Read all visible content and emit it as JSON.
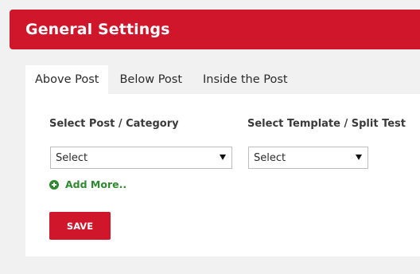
{
  "header": {
    "title": "General Settings"
  },
  "tabs": [
    {
      "label": "Above Post",
      "active": true
    },
    {
      "label": "Below Post",
      "active": false
    },
    {
      "label": "Inside the Post",
      "active": false
    }
  ],
  "form": {
    "post_category_label": "Select Post / Category",
    "template_label": "Select Template / Split Test",
    "post_category_select": {
      "value": "Select"
    },
    "template_select": {
      "value": "Select"
    },
    "add_more_label": "Add More..",
    "save_label": "SAVE"
  },
  "colors": {
    "brand": "#d0162a",
    "add_more": "#2e8a2e",
    "background": "#f1f1f1"
  },
  "icons": {
    "add_more": "plus-circle-icon",
    "select_caret": "caret-down-icon"
  }
}
